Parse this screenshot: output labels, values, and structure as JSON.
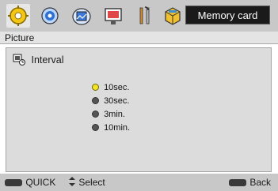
{
  "header": {
    "title": "Memory card",
    "tabs": [
      {
        "name": "setup-icon",
        "selected": true
      },
      {
        "name": "color-icon",
        "selected": false
      },
      {
        "name": "picture-icon",
        "selected": false
      },
      {
        "name": "display-icon",
        "selected": false
      },
      {
        "name": "tools-icon",
        "selected": false
      },
      {
        "name": "memory-card-icon",
        "selected": false
      }
    ]
  },
  "section": {
    "label": "Picture"
  },
  "panel": {
    "title": "Interval",
    "options": [
      {
        "label": "10sec.",
        "selected": true
      },
      {
        "label": "30sec.",
        "selected": false
      },
      {
        "label": "3min.",
        "selected": false
      },
      {
        "label": "10min.",
        "selected": false
      }
    ]
  },
  "footer": {
    "quick_label": "QUICK",
    "select_label": "Select",
    "back_label": "Back"
  },
  "colors": {
    "selected_dot": "#f3e22a",
    "unselected_dot": "#555555",
    "bar_bg": "#c8c8c8"
  }
}
